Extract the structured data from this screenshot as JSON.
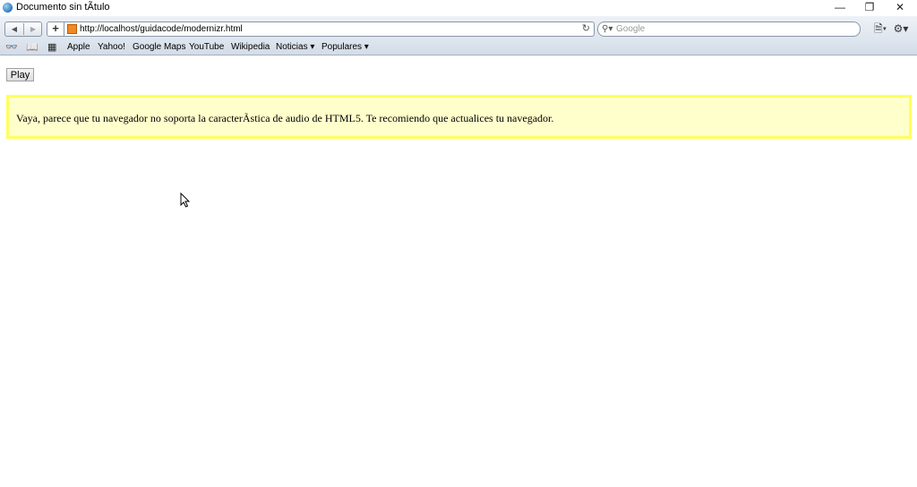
{
  "window": {
    "title": "Documento sin tÃ­tulo",
    "controls": {
      "minimize": "—",
      "restore": "❐",
      "close": "✕"
    }
  },
  "toolbar": {
    "back_glyph": "◀",
    "forward_glyph": "▶",
    "add_glyph": "+",
    "url": "http://localhost/guidacode/modernizr.html",
    "reload_glyph": "↻",
    "search_glyph": "⚲▾",
    "search_placeholder": "Google",
    "page_menu_glyph": "🗎▾",
    "settings_glyph": "⚙▾"
  },
  "bookmarks": {
    "icons": {
      "reading_list": "👓",
      "bookmarks_book": "📖",
      "top_sites": "▦"
    },
    "items": [
      {
        "label": "Apple"
      },
      {
        "label": "Yahoo!"
      },
      {
        "label": "Google Maps"
      },
      {
        "label": "YouTube"
      },
      {
        "label": "Wikipedia"
      },
      {
        "label": "Noticias ▾"
      },
      {
        "label": "Populares ▾"
      }
    ]
  },
  "page": {
    "play_button_label": "Play",
    "warning_text": "Vaya, parece que tu navegador no soporta la caracterÃ­stica de audio de HTML5. Te recomiendo que actualices tu navegador.",
    "colors": {
      "warning_bg": "#ffffcc",
      "warning_border": "#ffff5c"
    }
  }
}
